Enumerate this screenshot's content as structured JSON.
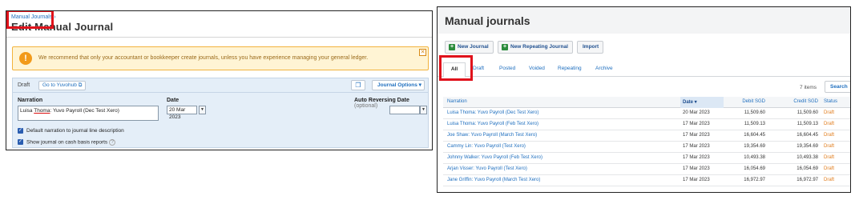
{
  "left": {
    "breadcrumb": "Manual Journals ›",
    "title": "Edit Manual Journal",
    "warning": "We recommend that only your accountant or bookkeeper create journals, unless you have experience managing your general ledger.",
    "warning_icon": "info-icon",
    "close_label": "✕",
    "status": "Draft",
    "goto_label": "Go to Yuvohub",
    "journal_options": "Journal Options ▾",
    "narration_label": "Narration",
    "narration_value_pre": "Luisa ",
    "narration_value_underlined": "Thoma",
    "narration_value_post": ": Yuvo Payroll (Dec Test Xero)",
    "date_label": "Date",
    "date_value": "20 Mar 2023",
    "auto_reversing_label": "Auto Reversing Date",
    "optional_label": "(optional)",
    "checkbox1": "Default narration to journal line description",
    "checkbox2": "Show journal on cash basis reports"
  },
  "right": {
    "title": "Manual journals",
    "buttons": {
      "new_journal": "New Journal",
      "new_repeating": "New Repeating Journal",
      "import": "Import"
    },
    "tabs": [
      "All",
      "Draft",
      "Posted",
      "Voided",
      "Repeating",
      "Archive"
    ],
    "items_count": "7 items",
    "search_label": "Search",
    "columns": {
      "narration": "Narration",
      "date": "Date ▾",
      "debit": "Debit SGD",
      "credit": "Credit SGD",
      "status": "Status"
    },
    "rows": [
      {
        "narration": "Luisa Thoma: Yuvo Payroll (Dec Test Xero)",
        "date": "20 Mar 2023",
        "debit": "11,509.60",
        "credit": "11,509.60",
        "status": "Draft"
      },
      {
        "narration": "Luisa Thoma: Yuvo Payroll (Feb Test Xero)",
        "date": "17 Mar 2023",
        "debit": "11,509.13",
        "credit": "11,509.13",
        "status": "Draft"
      },
      {
        "narration": "Joe Shaw: Yuvo Payroll (March Test Xero)",
        "date": "17 Mar 2023",
        "debit": "16,604.45",
        "credit": "16,604.45",
        "status": "Draft"
      },
      {
        "narration": "Cammy Lin: Yuvo Payroll (Test Xero)",
        "date": "17 Mar 2023",
        "debit": "19,354.69",
        "credit": "19,354.69",
        "status": "Draft"
      },
      {
        "narration": "Johnny Walker: Yuvo Payroll (Feb Test Xero)",
        "date": "17 Mar 2023",
        "debit": "10,493.38",
        "credit": "10,493.38",
        "status": "Draft"
      },
      {
        "narration": "Arjan Visser: Yuvo Payroll (Test Xero)",
        "date": "17 Mar 2023",
        "debit": "16,054.69",
        "credit": "16,054.69",
        "status": "Draft"
      },
      {
        "narration": "Jane Griffin: Yuvo Payroll (March Test Xero)",
        "date": "17 Mar 2023",
        "debit": "16,972.97",
        "credit": "16,972.97",
        "status": "Draft"
      }
    ]
  },
  "colors": {
    "highlight": "#e0121b",
    "link": "#1f6fbf",
    "draft_status": "#e07b1a",
    "warning_bg": "#fff4d4"
  }
}
